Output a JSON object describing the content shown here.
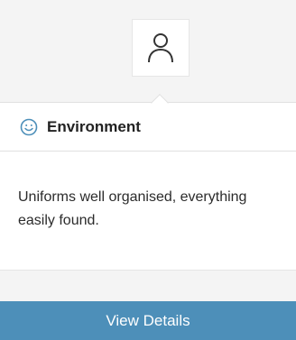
{
  "avatar": {
    "icon": "user-icon"
  },
  "category": {
    "icon": "smiley-icon",
    "label": "Environment",
    "accent": "#4d8fb9"
  },
  "comment": {
    "text": "Uniforms well organised, everything easily found."
  },
  "actions": {
    "view_details_label": "View Details",
    "button_color": "#4d8fb9"
  }
}
